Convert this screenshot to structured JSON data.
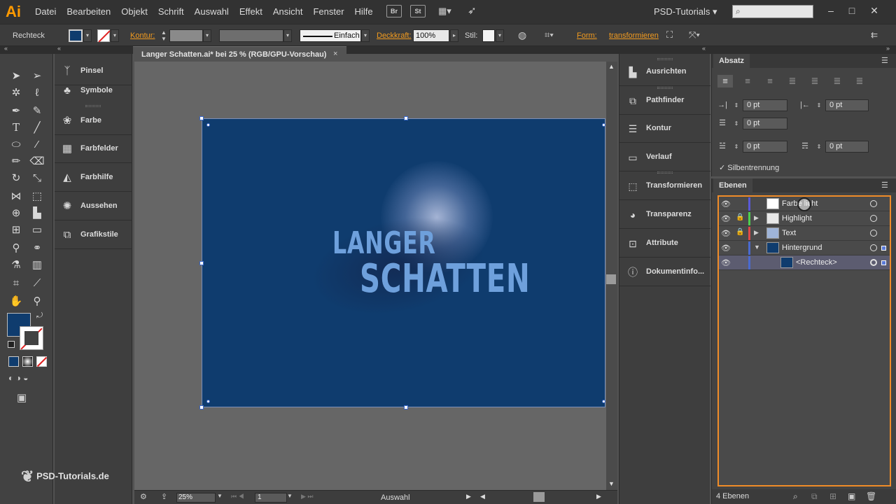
{
  "app": {
    "logo": "Ai",
    "workspace": "PSD-Tutorials",
    "bridge_label": "Br",
    "stock_label": "St"
  },
  "menu": [
    "Datei",
    "Bearbeiten",
    "Objekt",
    "Schrift",
    "Auswahl",
    "Effekt",
    "Ansicht",
    "Fenster",
    "Hilfe"
  ],
  "control": {
    "object_type": "Rechteck",
    "kontur_label": "Kontur:",
    "stroke_style": "Einfach",
    "opacity_label": "Deckkraft:",
    "opacity_value": "100%",
    "style_label": "Stil:",
    "form_label": "Form:",
    "transform_label": "transformieren"
  },
  "document": {
    "tab_title": "Langer Schatten.ai* bei 25 % (RGB/GPU-Vorschau)",
    "close": "×"
  },
  "artwork": {
    "line1": "LANGER",
    "line2": "SCHATTEN",
    "background_color": "#0f3c6e",
    "text_color": "#6ea0dc"
  },
  "panels_left": [
    {
      "label": "Pinsel",
      "icon": "brush-icon"
    },
    {
      "label": "Symbole",
      "icon": "symbols-icon"
    },
    {
      "label": "Farbe",
      "icon": "palette-icon"
    },
    {
      "label": "Farbfelder",
      "icon": "swatches-icon"
    },
    {
      "label": "Farbhilfe",
      "icon": "color-guide-icon"
    },
    {
      "label": "Aussehen",
      "icon": "appearance-icon"
    },
    {
      "label": "Grafikstile",
      "icon": "graphic-styles-icon"
    }
  ],
  "panels_right": [
    {
      "label": "Ausrichten",
      "icon": "align-icon"
    },
    {
      "label": "Pathfinder",
      "icon": "pathfinder-icon"
    },
    {
      "label": "Kontur",
      "icon": "stroke-icon"
    },
    {
      "label": "Verlauf",
      "icon": "gradient-icon"
    },
    {
      "label": "Transformieren",
      "icon": "transform-icon"
    },
    {
      "label": "Transparenz",
      "icon": "transparency-icon"
    },
    {
      "label": "Attribute",
      "icon": "attributes-icon"
    },
    {
      "label": "Dokumentinfo...",
      "icon": "document-info-icon"
    }
  ],
  "absatz": {
    "title": "Absatz",
    "indent_left": "0 pt",
    "indent_right": "0 pt",
    "first_line": "0 pt",
    "space_before": "0 pt",
    "space_after": "0 pt",
    "hyphenation": "Silbentrennung"
  },
  "ebenen": {
    "title": "Ebenen",
    "count": "4 Ebenen",
    "layers": [
      {
        "name": "Farbe licht",
        "color": "#5a5ad8",
        "thumb": "#ffffff"
      },
      {
        "name": "Highlight",
        "color": "#4ecf4e",
        "thumb": "#e8e8e8"
      },
      {
        "name": "Text",
        "color": "#e04848",
        "thumb": "#9fb4d8"
      },
      {
        "name": "Hintergrund",
        "color": "#4a6ad0",
        "thumb": "#0f3c6e"
      },
      {
        "name": "<Rechteck>",
        "color": "#4a6ad0",
        "thumb": "#0f3c6e"
      }
    ]
  },
  "status": {
    "zoom": "25%",
    "artboard": "1",
    "mode": "Auswahl"
  },
  "watermark": "PSD-Tutorials.de",
  "colors": {
    "fill": "#0f3c6e",
    "accent": "#f08c28",
    "logo": "#ff9a00"
  }
}
